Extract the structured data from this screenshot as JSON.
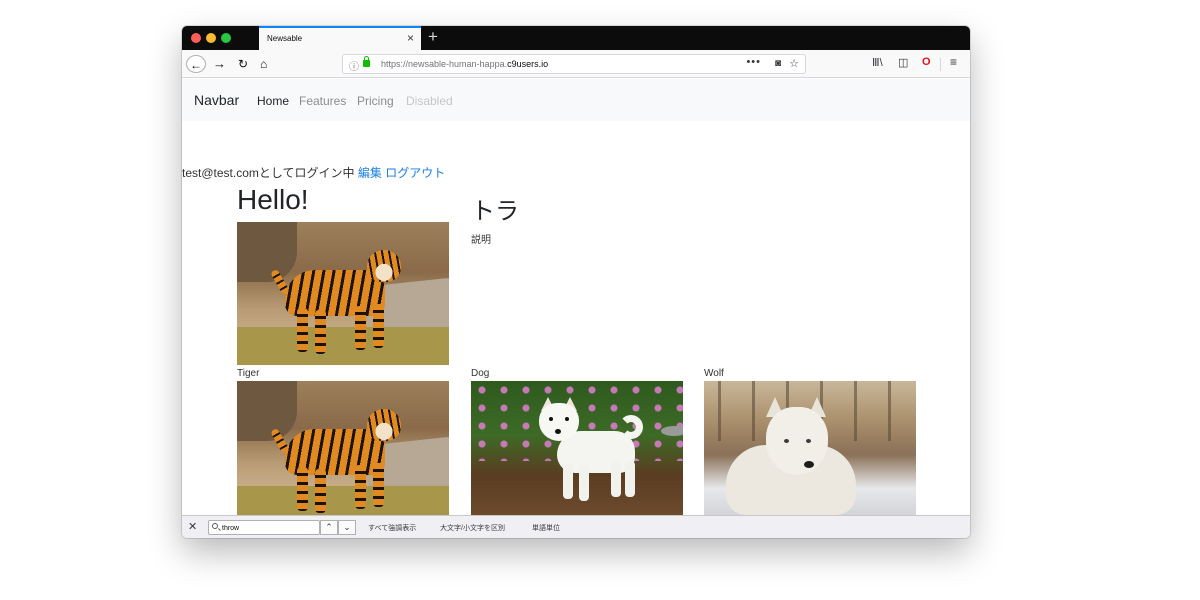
{
  "browser": {
    "tab_title": "Newsable",
    "new_tab": "+",
    "tab_close": "×",
    "url_prefix": "https://newsable-human-happa.",
    "url_host": "c9users.io",
    "url_more": "•••"
  },
  "navbar": {
    "brand": "Navbar",
    "links": [
      "Home",
      "Features",
      "Pricing",
      "Disabled"
    ]
  },
  "login": {
    "text": "test@test.comとしてログイン中",
    "edit": "編集",
    "logout": "ログアウト"
  },
  "page": {
    "heading": "Hello!",
    "featured": {
      "title": "トラ",
      "description": "説明"
    },
    "captions": [
      "Tiger",
      "Dog",
      "Wolf"
    ]
  },
  "findbar": {
    "query": "throw",
    "highlight_all": "すべて強調表示",
    "match_case": "大文字/小文字を区別",
    "whole_words": "単語単位"
  },
  "icons": {
    "back": "back-arrow-icon",
    "forward": "forward-arrow-icon",
    "reload": "reload-icon",
    "home": "home-icon",
    "info": "info-icon",
    "lock": "lock-icon",
    "pocket": "pocket-icon",
    "bookmark": "star-icon",
    "library": "library-icon",
    "sidebar": "sidebar-icon",
    "opera": "opera-icon",
    "menu": "hamburger-menu-icon"
  }
}
